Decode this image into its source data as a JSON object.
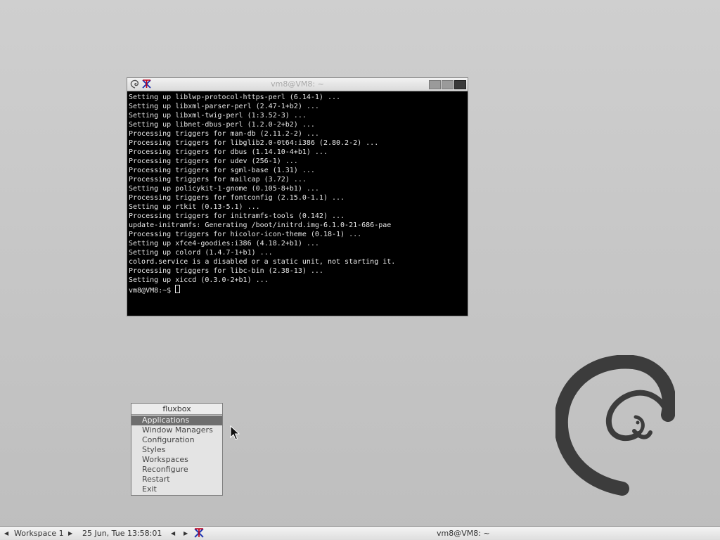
{
  "terminal": {
    "title": "vm8@VM8: ~",
    "lines": [
      "Setting up liblwp-protocol-https-perl (6.14-1) ...",
      "Setting up libxml-parser-perl (2.47-1+b2) ...",
      "Setting up libxml-twig-perl (1:3.52-3) ...",
      "Setting up libnet-dbus-perl (1.2.0-2+b2) ...",
      "Processing triggers for man-db (2.11.2-2) ...",
      "Processing triggers for libglib2.0-0t64:i386 (2.80.2-2) ...",
      "Processing triggers for dbus (1.14.10-4+b1) ...",
      "Processing triggers for udev (256-1) ...",
      "Processing triggers for sgml-base (1.31) ...",
      "Processing triggers for mailcap (3.72) ...",
      "Setting up policykit-1-gnome (0.105-8+b1) ...",
      "Processing triggers for fontconfig (2.15.0-1.1) ...",
      "Setting up rtkit (0.13-5.1) ...",
      "Processing triggers for initramfs-tools (0.142) ...",
      "update-initramfs: Generating /boot/initrd.img-6.1.0-21-686-pae",
      "Processing triggers for hicolor-icon-theme (0.18-1) ...",
      "Setting up xfce4-goodies:i386 (4.18.2+b1) ...",
      "Setting up colord (1.4.7-1+b1) ...",
      "colord.service is a disabled or a static unit, not starting it.",
      "Processing triggers for libc-bin (2.38-13) ...",
      "Setting up xiccd (0.3.0-2+b1) ..."
    ],
    "prompt": "vm8@VM8:~$ "
  },
  "rootmenu": {
    "title": "fluxbox",
    "items": [
      "Applications",
      "Window Managers",
      "Configuration",
      "Styles",
      "Workspaces",
      "Reconfigure",
      "Restart",
      "Exit"
    ],
    "selected_index": 0
  },
  "toolbar": {
    "prev_workspace": "◀",
    "workspace": "Workspace 1",
    "next_workspace": "▶",
    "clock": "25 Jun, Tue 13:58:01",
    "prev_window": "◀",
    "next_window": "▶",
    "task_title": "vm8@VM8: ~"
  },
  "colors": {
    "terminal_bg": "#000000",
    "terminal_fg": "#e8e8e8",
    "menu_selected": "#6e6e6e",
    "xterm_icon_red": "#c0001a",
    "xterm_icon_blue": "#1a2fb0"
  }
}
